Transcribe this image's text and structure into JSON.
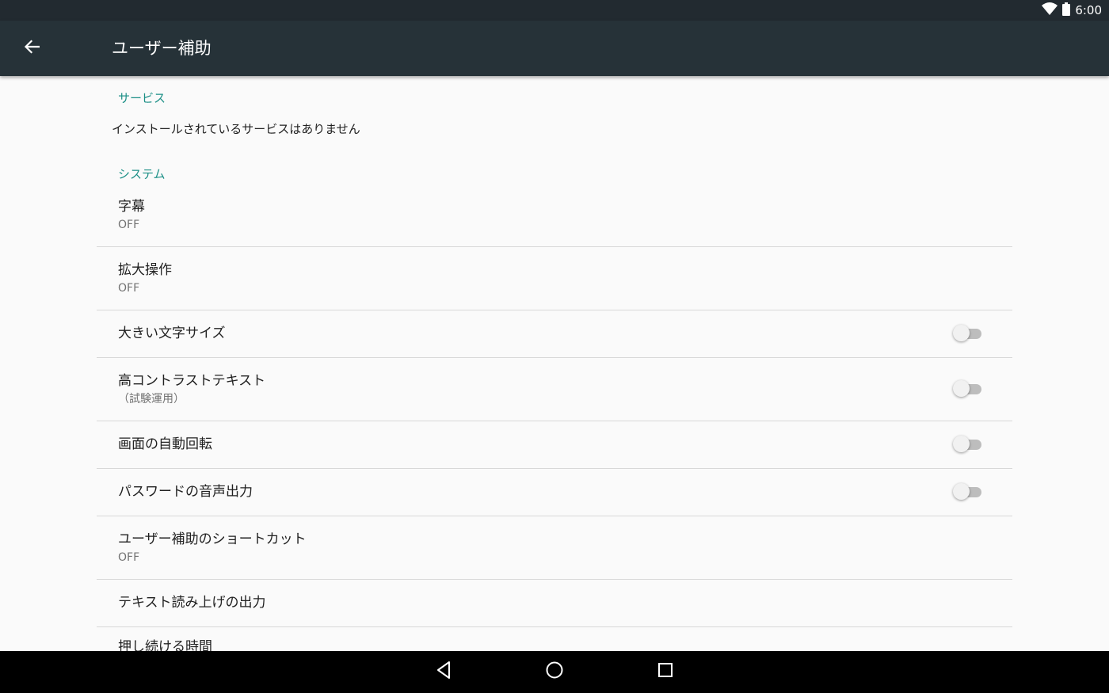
{
  "status_bar": {
    "time": "6:00",
    "icons": [
      "wifi-icon",
      "battery-icon"
    ]
  },
  "app_bar": {
    "title": "ユーザー補助",
    "back_icon": "arrow-back-icon"
  },
  "sections": {
    "services": {
      "header": "サービス",
      "empty_text": "インストールされているサービスはありません"
    },
    "system": {
      "header": "システム"
    }
  },
  "prefs": [
    {
      "title": "字幕",
      "summary": "OFF"
    },
    {
      "title": "拡大操作",
      "summary": "OFF"
    },
    {
      "title": "大きい文字サイズ",
      "switch_on": false
    },
    {
      "title": "高コントラストテキスト",
      "summary": "（試験運用）",
      "switch_on": false
    },
    {
      "title": "画面の自動回転",
      "switch_on": false
    },
    {
      "title": "パスワードの音声出力",
      "switch_on": false
    },
    {
      "title": "ユーザー補助のショートカット",
      "summary": "OFF"
    },
    {
      "title": "テキスト読み上げの出力"
    },
    {
      "title": "押し続ける時間"
    }
  ],
  "nav_bar": {
    "icons": [
      "back-triangle-icon",
      "home-circle-icon",
      "recents-square-icon"
    ]
  },
  "colors": {
    "status_bar": "#222a30",
    "app_bar": "#263238",
    "accent": "#1b8f86",
    "background": "#fafafa"
  }
}
